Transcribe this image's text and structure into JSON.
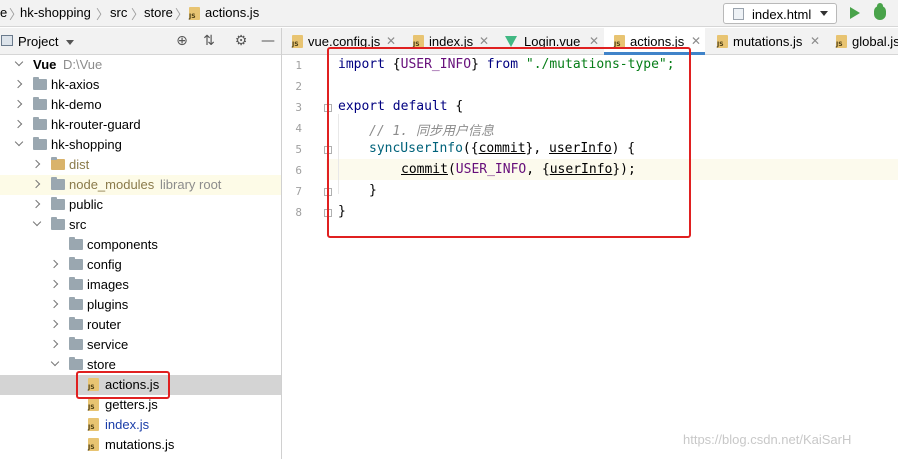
{
  "breadcrumb": {
    "items": [
      "e",
      "hk-shopping",
      "src",
      "store",
      "actions.js"
    ]
  },
  "run_config": {
    "label": "index.html"
  },
  "project_panel": {
    "title": "Project"
  },
  "tree": [
    {
      "label": "Vue",
      "sub": "D:\\Vue",
      "depth": 0,
      "expanded": true,
      "bold": true
    },
    {
      "label": "hk-axios",
      "depth": 1,
      "expanded": false
    },
    {
      "label": "hk-demo",
      "depth": 1,
      "expanded": false
    },
    {
      "label": "hk-router-guard",
      "depth": 1,
      "expanded": false
    },
    {
      "label": "hk-shopping",
      "depth": 1,
      "expanded": true
    },
    {
      "label": "dist",
      "depth": 2,
      "expanded": false,
      "tan": true
    },
    {
      "label": "node_modules",
      "sub": "library root",
      "depth": 2,
      "expanded": false,
      "highlight": true
    },
    {
      "label": "public",
      "depth": 2,
      "expanded": false
    },
    {
      "label": "src",
      "depth": 2,
      "expanded": true
    },
    {
      "label": "components",
      "depth": 3,
      "leaf": true
    },
    {
      "label": "config",
      "depth": 3,
      "expanded": false
    },
    {
      "label": "images",
      "depth": 3,
      "expanded": false
    },
    {
      "label": "plugins",
      "depth": 3,
      "expanded": false
    },
    {
      "label": "router",
      "depth": 3,
      "expanded": false
    },
    {
      "label": "service",
      "depth": 3,
      "expanded": false
    },
    {
      "label": "store",
      "depth": 3,
      "expanded": true
    },
    {
      "label": "actions.js",
      "depth": 4,
      "file": true,
      "selected": true
    },
    {
      "label": "getters.js",
      "depth": 4,
      "file": true
    },
    {
      "label": "index.js",
      "depth": 4,
      "file": true,
      "blue": true
    },
    {
      "label": "mutations.js",
      "depth": 4,
      "file": true
    }
  ],
  "tabs": [
    {
      "label": "vue.config.js",
      "icon": "js-file-icon"
    },
    {
      "label": "index.js",
      "icon": "js-file-icon"
    },
    {
      "label": "Login.vue",
      "icon": "vue-file-icon"
    },
    {
      "label": "actions.js",
      "icon": "js-file-icon",
      "active": true
    },
    {
      "label": "mutations.js",
      "icon": "js-file-icon"
    },
    {
      "label": "global.js",
      "icon": "js-file-icon"
    }
  ],
  "code": {
    "line_numbers": [
      "1",
      "2",
      "3",
      "4",
      "5",
      "6",
      "7",
      "8"
    ],
    "l1": {
      "import": "import",
      "brace_open": " {",
      "name": "USER_INFO",
      "brace_close": "} ",
      "from": "from",
      "path": " \"./mutations-type\";"
    },
    "l3": {
      "export": "export",
      "default": " default",
      "rest": " {"
    },
    "l4": {
      "comment": "// 1. 同步用户信息"
    },
    "l5": {
      "fn": "syncUserInfo",
      "p1": "({",
      "commit": "commit",
      "p2": "}, ",
      "userInfo": "userInfo",
      "p3": ") {"
    },
    "l6": {
      "commit": "commit",
      "p1": "(",
      "const": "USER_INFO",
      "p2": ", {",
      "userInfo": "userInfo",
      "p3": "});"
    },
    "l7": {
      "text": "}"
    },
    "l8": {
      "text": "}"
    }
  },
  "watermark": "https://blog.csdn.net/KaiSarH"
}
